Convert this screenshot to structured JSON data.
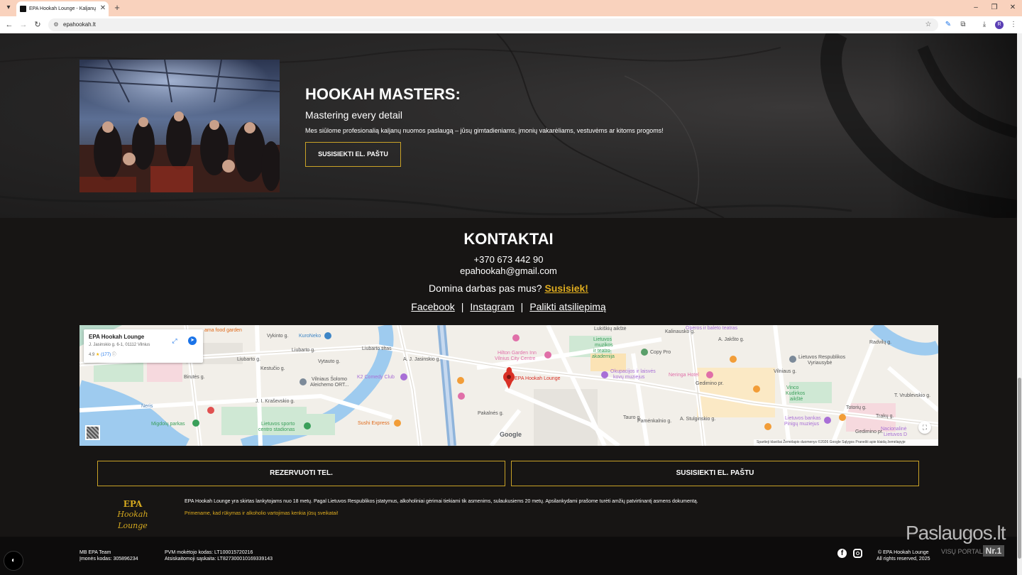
{
  "browser": {
    "tab_title": "EPA Hookah Lounge - Kaljanų b",
    "tab_close": "✕",
    "new_tab": "+",
    "url": "epahookah.lt",
    "profile_initial": "R",
    "window_controls": [
      "–",
      "❐",
      "✕"
    ]
  },
  "hero": {
    "heading": "HOOKAH MASTERS:",
    "subheading": "Mastering every detail",
    "description": "Mes siūlome profesionalią kaljanų nuomos paslaugą – jūsų gimtadieniams, įmonių vakarėliams, vestuvėms ar kitoms progoms!",
    "button_label": "SUSISIEKTI EL. PAŠTU"
  },
  "contacts": {
    "title": "KONTAKTAI",
    "phone": "+370 673 442 90",
    "email": "epahookah@gmail.com",
    "job_question": "Domina darbas pas mus?",
    "job_link": "Susisiek!",
    "social": {
      "facebook": "Facebook",
      "separator": "|",
      "instagram": "Instagram",
      "review": "Palikti atsiliepimą"
    }
  },
  "map": {
    "card_name": "EPA Hookah Lounge",
    "card_address": "J. Jasinskio g. 6-1, 01112 Vilnius",
    "card_rating": "4.9",
    "card_stars": "★",
    "card_reviews": "(177)",
    "card_info": "ⓘ",
    "pin_label": "EPA Hookah Lounge",
    "google_logo": "Google",
    "attribution": "Spartieji klavišai    Žemėlapio duomenys ©2026 Google    Sąlygos    Pranešti apie klaidą žemėlapyje",
    "labels": [
      "ama food garden",
      "KuroNeko",
      "Liubarto g.",
      "Liubarto g.",
      "Liubarto tiltas",
      "A. J. Jasinskio g.",
      "Hilton Garden Inn",
      "Vilnius City Centre",
      "K2 Comedy Club",
      "Vilniaus Šolomo",
      "Aleichemo ORT...",
      "J. I. Kraševskio g.",
      "Lietuvos sporto",
      "centro stadionas",
      "Migdolų parkas",
      "Sushi Express",
      "Pakalnės g.",
      "Lukiškių aikštė",
      "Lietuvos",
      "muzikos",
      "ir teatro",
      "akademija",
      "Copy Pro",
      "Okupacijos ir laisvės",
      "kovų muziejus",
      "Neringa Hotel",
      "Gedimino pr.",
      "Lietuvos Respublikos",
      "Vyriausybė",
      "Vinco",
      "Kudirkos",
      "aikštė",
      "Lietuvos bankas",
      "Pinigų muziejus",
      "Nacionalinė",
      "Lietuvos D",
      "Gedimino pr.",
      "Vilniaus g.",
      "T. Vrublevskio g.",
      "Operos ir baleto teatras",
      "Pamėnkalnio g.",
      "Birutės g.",
      "Neris",
      "Kestučio g.",
      "Vytauto g.",
      "A. Jakšto g.",
      "A. Stulginskio g.",
      "Tauro g.",
      "Trakų g.",
      "Totorių g.",
      "Kalinausko g.",
      "Vykinto g.",
      "Radvilų g."
    ]
  },
  "cta": {
    "call_label": "REZERVUOTI TEL.",
    "email_label": "SUSISIEKTI EL. PAŠTU"
  },
  "brand": {
    "logo_line1": "EPA",
    "logo_line2": "Hookah Lounge"
  },
  "notices": {
    "legal": "EPA Hookah Lounge yra skirtas lankytojams nuo 18 metų. Pagal Lietuvos Respublikos įstatymus, alkoholiniai gėrimai tiekiami tik asmenims, sulaukusiems 20 metų. Apsilankydami prašome turėti amžių patvirtinantį asmens dokumentą.",
    "health": "Primename, kad rūkymas ir alkoholio vartojimas kenkia jūsų sveikatai!"
  },
  "bottom_bar": {
    "company": "MB EPA Team",
    "company_code": "Įmonės kodas: 305896234",
    "vat_code": "PVM mokėtojo kodas: LT100015720216",
    "account": "Atsiskaitomoji sąskaita: LT827300010169339143",
    "copyright": "© EPA Hookah Lounge",
    "rights": "All rights reserved, 2025"
  },
  "watermark": {
    "main": "Paslaugos.lt",
    "sub": "VISŲ PORTALAS",
    "nr": "Nr.1"
  },
  "colors": {
    "accent": "#e0ad1f",
    "background": "#171514",
    "browser_frame": "#f9d2bd"
  }
}
